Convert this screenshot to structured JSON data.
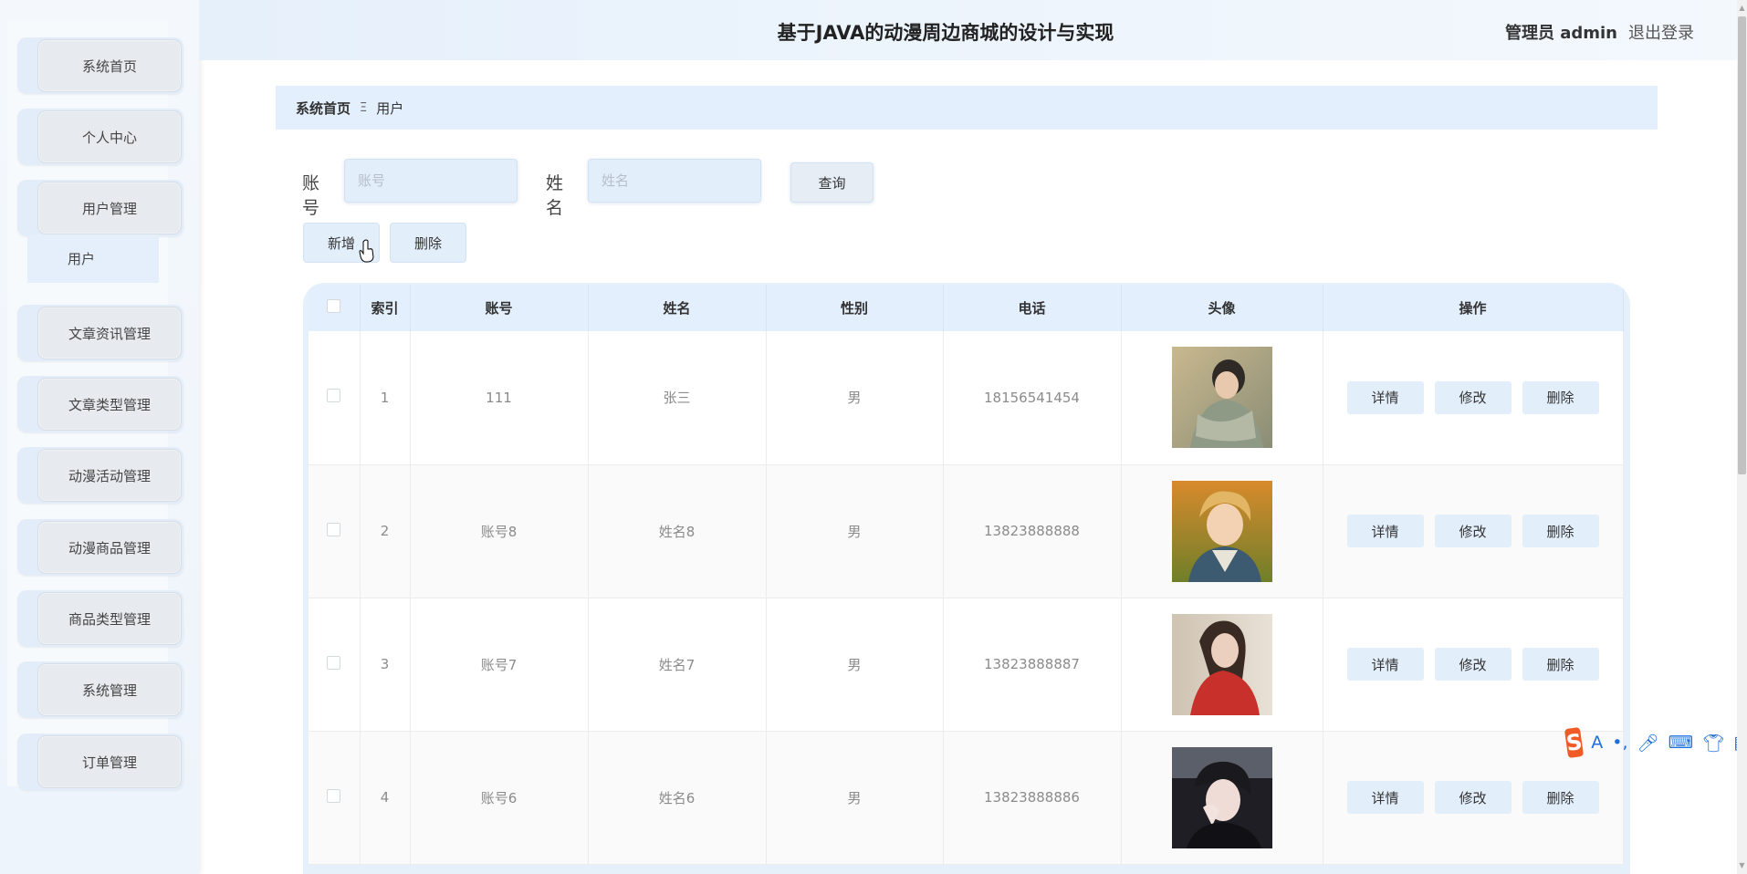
{
  "header": {
    "title": "基于JAVA的动漫周边商城的设计与实现",
    "role_user": "管理员 admin",
    "logout": "退出登录"
  },
  "sidebar": {
    "items": [
      {
        "label": "系统首页"
      },
      {
        "label": "个人中心"
      },
      {
        "label": "用户管理"
      },
      {
        "label": "文章资讯管理"
      },
      {
        "label": "文章类型管理"
      },
      {
        "label": "动漫活动管理"
      },
      {
        "label": "动漫商品管理"
      },
      {
        "label": "商品类型管理"
      },
      {
        "label": "系统管理"
      },
      {
        "label": "订单管理"
      }
    ],
    "submenu_user": "用户"
  },
  "breadcrumb": {
    "home": "系统首页",
    "separator_glyph": "Ξ",
    "current": "用户"
  },
  "search": {
    "account_label": "账号",
    "account_placeholder": "账号",
    "name_label": "姓名",
    "name_placeholder": "姓名",
    "query_button": "查询"
  },
  "actions": {
    "add": "新增",
    "delete": "删除"
  },
  "table": {
    "columns": [
      "索引",
      "账号",
      "姓名",
      "性别",
      "电话",
      "头像",
      "操作"
    ],
    "rows": [
      {
        "index": "1",
        "account": "111",
        "name": "张三",
        "gender": "男",
        "phone": "18156541454"
      },
      {
        "index": "2",
        "account": "账号8",
        "name": "姓名8",
        "gender": "男",
        "phone": "13823888888"
      },
      {
        "index": "3",
        "account": "账号7",
        "name": "姓名7",
        "gender": "男",
        "phone": "13823888887"
      },
      {
        "index": "4",
        "account": "账号6",
        "name": "姓名6",
        "gender": "男",
        "phone": "13823888886"
      }
    ],
    "op_labels": {
      "detail": "详情",
      "edit": "修改",
      "delete": "删除"
    }
  },
  "ime": {
    "logo": "S",
    "glyph": "A"
  },
  "colors": {
    "accent_bg": "#e3eefb",
    "header_bg": "#e6f0fb",
    "text_muted": "#8b8b8b"
  }
}
